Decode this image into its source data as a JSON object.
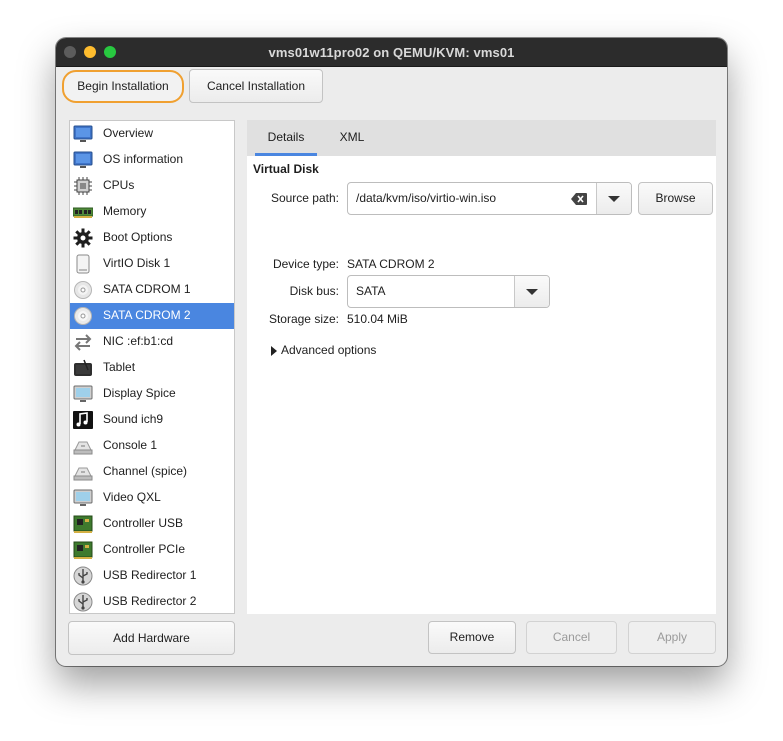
{
  "window": {
    "title": "vms01w11pro02 on QEMU/KVM: vms01"
  },
  "toolbar": {
    "begin_label": "Begin Installation",
    "cancel_label": "Cancel Installation"
  },
  "sidebar": {
    "items": [
      {
        "label": "Overview",
        "icon": "monitor-icon"
      },
      {
        "label": "OS information",
        "icon": "monitor-icon"
      },
      {
        "label": "CPUs",
        "icon": "cpu-icon"
      },
      {
        "label": "Memory",
        "icon": "memory-icon"
      },
      {
        "label": "Boot Options",
        "icon": "gear-icon"
      },
      {
        "label": "VirtIO Disk 1",
        "icon": "disk-icon"
      },
      {
        "label": "SATA CDROM 1",
        "icon": "cdrom-icon"
      },
      {
        "label": "SATA CDROM 2",
        "icon": "cdrom-icon",
        "selected": true
      },
      {
        "label": "NIC :ef:b1:cd",
        "icon": "network-icon"
      },
      {
        "label": "Tablet",
        "icon": "tablet-icon"
      },
      {
        "label": "Display Spice",
        "icon": "display-icon"
      },
      {
        "label": "Sound ich9",
        "icon": "sound-icon"
      },
      {
        "label": "Console 1",
        "icon": "console-icon"
      },
      {
        "label": "Channel (spice)",
        "icon": "console-icon"
      },
      {
        "label": "Video QXL",
        "icon": "display-icon"
      },
      {
        "label": "Controller USB",
        "icon": "controller-icon"
      },
      {
        "label": "Controller PCIe",
        "icon": "controller-icon"
      },
      {
        "label": "USB Redirector 1",
        "icon": "usb-icon"
      },
      {
        "label": "USB Redirector 2",
        "icon": "usb-icon"
      }
    ],
    "add_hardware_label": "Add Hardware"
  },
  "tabs": [
    {
      "label": "Details"
    },
    {
      "label": "XML"
    }
  ],
  "details": {
    "section_title": "Virtual Disk",
    "source_path_label": "Source path:",
    "source_path_value": "/data/kvm/iso/virtio-win.iso",
    "browse_label": "Browse",
    "device_type_label": "Device type:",
    "device_type_value": "SATA CDROM 2",
    "disk_bus_label": "Disk bus:",
    "disk_bus_value": "SATA",
    "storage_size_label": "Storage size:",
    "storage_size_value": "510.04 MiB",
    "advanced_label": "Advanced options"
  },
  "footer": {
    "remove_label": "Remove",
    "cancel_label": "Cancel",
    "apply_label": "Apply"
  },
  "colors": {
    "selection": "#4a86e0",
    "highlight_ring": "#f0a030"
  }
}
